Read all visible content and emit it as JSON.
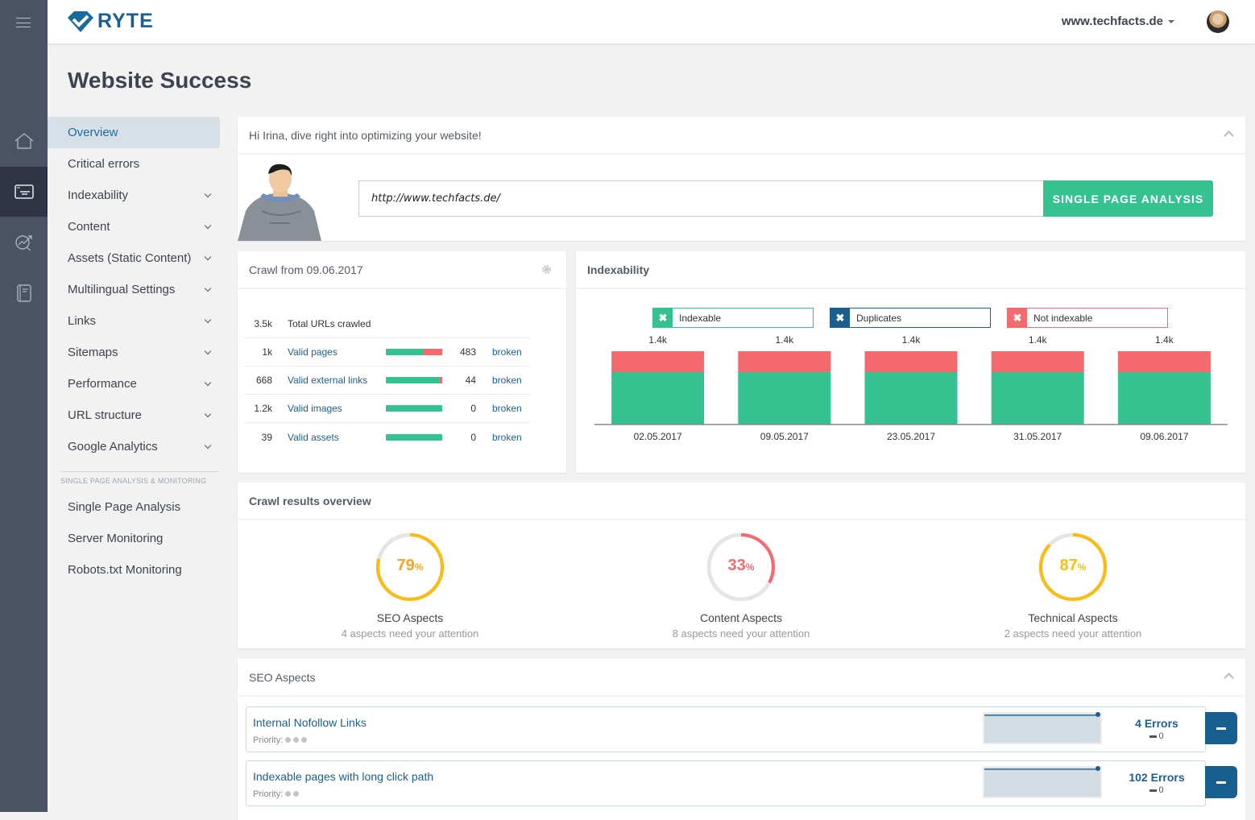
{
  "header": {
    "brand": "RYTE",
    "site_selector": "www.techfacts.de",
    "page_title": "Website Success"
  },
  "rail": {
    "items": [
      {
        "icon": "home-icon"
      },
      {
        "icon": "website-success-icon",
        "active": true
      },
      {
        "icon": "analytics-search-icon"
      },
      {
        "icon": "book-icon"
      }
    ]
  },
  "nav": {
    "items": [
      {
        "label": "Overview",
        "active": true,
        "expandable": false
      },
      {
        "label": "Critical errors",
        "expandable": false
      },
      {
        "label": "Indexability",
        "expandable": true
      },
      {
        "label": "Content",
        "expandable": true
      },
      {
        "label": "Assets (Static Content)",
        "expandable": true
      },
      {
        "label": "Multilingual Settings",
        "expandable": true
      },
      {
        "label": "Links",
        "expandable": true
      },
      {
        "label": "Sitemaps",
        "expandable": true
      },
      {
        "label": "Performance",
        "expandable": true
      },
      {
        "label": "URL structure",
        "expandable": true
      },
      {
        "label": "Google Analytics",
        "expandable": true
      }
    ],
    "section_title": "SINGLE PAGE ANALYSIS & MONITORING",
    "section_items": [
      {
        "label": "Single Page Analysis"
      },
      {
        "label": "Server Monitoring"
      },
      {
        "label": "Robots.txt Monitoring"
      }
    ]
  },
  "welcome": {
    "title": "Hi Irina, dive right into optimizing your website!",
    "url_value": "http://www.techfacts.de/",
    "button": "SINGLE PAGE ANALYSIS"
  },
  "crawl": {
    "title": "Crawl from 09.06.2017",
    "total": {
      "value": "3.5k",
      "label": "Total URLs crawled"
    },
    "rows": [
      {
        "value": "1k",
        "label": "Valid pages",
        "broken": "483",
        "broken_label": "broken",
        "broken_fraction": 0.33
      },
      {
        "value": "668",
        "label": "Valid external links",
        "broken": "44",
        "broken_label": "broken",
        "broken_fraction": 0.06
      },
      {
        "value": "1.2k",
        "label": "Valid images",
        "broken": "0",
        "broken_label": "broken",
        "broken_fraction": 0
      },
      {
        "value": "39",
        "label": "Valid assets",
        "broken": "0",
        "broken_label": "broken",
        "broken_fraction": 0
      }
    ]
  },
  "chart_data": {
    "type": "bar",
    "title": "Indexability",
    "stacked": true,
    "categories": [
      "02.05.2017",
      "09.05.2017",
      "23.05.2017",
      "31.05.2017",
      "09.06.2017"
    ],
    "totals_labels": [
      "1.4k",
      "1.4k",
      "1.4k",
      "1.4k",
      "1.4k"
    ],
    "series": [
      {
        "name": "Indexable",
        "color": "#36c190",
        "values": [
          1000,
          1000,
          1000,
          1000,
          1000
        ]
      },
      {
        "name": "Duplicates",
        "color": "#1b5f8f",
        "values": [
          0,
          0,
          0,
          0,
          0
        ]
      },
      {
        "name": "Not indexable",
        "color": "#f46a6f",
        "values": [
          400,
          400,
          400,
          400,
          400
        ]
      }
    ],
    "ylim": [
      0,
      1400
    ],
    "grid": false,
    "legend": "top"
  },
  "results": {
    "title": "Crawl results overview",
    "gauges": [
      {
        "value": 79,
        "unit": "%",
        "title": "SEO Aspects",
        "subtitle": "4 aspects need your attention",
        "color": "#fbbd0d",
        "text_color": "#f5a623"
      },
      {
        "value": 33,
        "unit": "%",
        "title": "Content Aspects",
        "subtitle": "8 aspects need your attention",
        "color": "#f46a6f",
        "text_color": "#f46a6f"
      },
      {
        "value": 87,
        "unit": "%",
        "title": "Technical Aspects",
        "subtitle": "2 aspects need your attention",
        "color": "#fbbd0d",
        "text_color": "#fbbd0d"
      }
    ]
  },
  "seo_aspects": {
    "title": "SEO Aspects",
    "items": [
      {
        "name": "Internal Nofollow Links",
        "priority_label": "Priority:",
        "priority": 3,
        "errors": "4 Errors",
        "delta": "0"
      },
      {
        "name": "Indexable pages with long click path",
        "priority_label": "Priority:",
        "priority": 2,
        "errors": "102 Errors",
        "delta": "0"
      }
    ]
  }
}
